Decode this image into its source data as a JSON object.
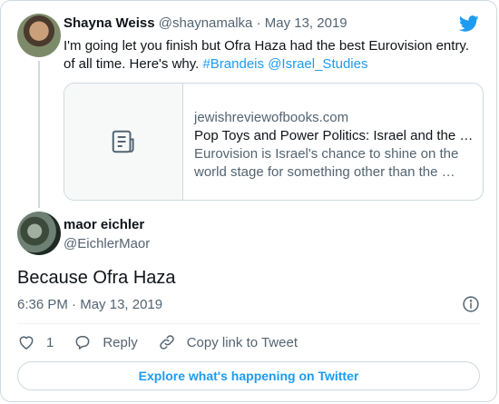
{
  "parent_tweet": {
    "author_name": "Shayna Weiss",
    "author_handle": "@shaynamalka",
    "separator": "·",
    "date": "May 13, 2019",
    "text_plain": "I'm going let you finish but Ofra Haza had the best Eurovision entry. of all time. Here's why. ",
    "hashtag": "#Brandeis",
    "mention": "@Israel_Studies",
    "link_card": {
      "icon": "document-icon",
      "domain": "jewishreviewofbooks.com",
      "title": "Pop Toys and Power Politics: Israel and the …",
      "description": "Eurovision is Israel's chance to shine on the world stage for something other than the …"
    }
  },
  "main_tweet": {
    "author_name": "maor eichler",
    "author_handle": "@EichlerMaor",
    "text": "Because Ofra Haza",
    "time": "6:36 PM",
    "separator": "·",
    "date": "May 13, 2019"
  },
  "actions": {
    "like_count": "1",
    "reply_label": "Reply",
    "copy_link_label": "Copy link to Tweet"
  },
  "explore_label": "Explore what's happening on Twitter",
  "colors": {
    "accent": "#1d9bf0",
    "muted": "#536471",
    "like_red": "#f91880"
  }
}
